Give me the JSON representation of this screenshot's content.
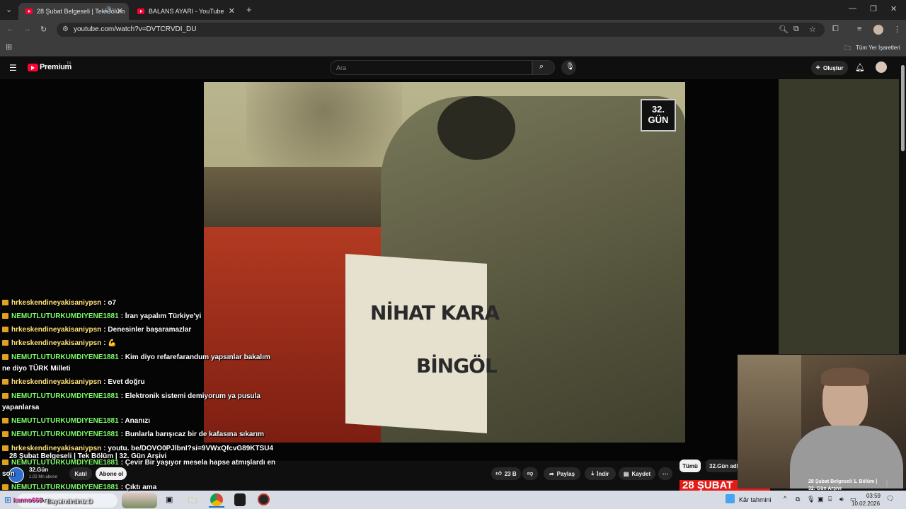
{
  "browser": {
    "tabs": [
      {
        "label": "28 Şubat Belgeseli | Tek Bölüm",
        "active": true
      },
      {
        "label": "BALANS AYARI - YouTube",
        "active": false
      }
    ],
    "url": "youtube.com/watch?v=DVTCRVDI_DU",
    "bookmarks_label": "Tüm Yer İşaretleri"
  },
  "youtube": {
    "logo_text": "Premium",
    "logo_superscript": "TR",
    "search_placeholder": "Ara",
    "create_label": "Oluştur"
  },
  "video": {
    "watermark": "32.\nGÜN",
    "sign_line1": "NİHAT KARA",
    "sign_line2": "BİNGÖL",
    "title": "28 Şubat Belgeseli | Tek Bölüm | 32. Gün Arşivi",
    "channel_name": "32.Gün",
    "subscribers": "1,02 Mn abone",
    "join_label": "Katıl",
    "subscribe_label": "Abone ol",
    "likes": "23 B",
    "share_label": "Paylaş",
    "download_label": "İndir",
    "save_label": "Kaydet"
  },
  "chat": [
    {
      "user": "hrkeskendineyakisaniypsn",
      "user_color": "yellow",
      "text": ": o7"
    },
    {
      "user": "NEMUTLUTURKUMDIYENE1881",
      "user_color": "green",
      "text": ": İran yapalım Türkiye'yi"
    },
    {
      "user": "hrkeskendineyakisaniypsn",
      "user_color": "yellow",
      "text": ": Denesinler başaramazlar"
    },
    {
      "user": "hrkeskendineyakisaniypsn",
      "user_color": "yellow",
      "text": ": 💪"
    },
    {
      "user": "NEMUTLUTURKUMDIYENE1881",
      "user_color": "green",
      "text": ": Kim diyo refarefarandum yapsınlar bakalım",
      "cont": "ne diyo TÜRK Milleti"
    },
    {
      "user": "hrkeskendineyakisaniypsn",
      "user_color": "yellow",
      "text": ": Evet doğru"
    },
    {
      "user": "NEMUTLUTURKUMDIYENE1881",
      "user_color": "green",
      "text": ": Elektronik sistemi demiyorum ya pusula",
      "cont": "yapanlarsa"
    },
    {
      "user": "NEMUTLUTURKUMDIYENE1881",
      "user_color": "green",
      "text": ": Ananızı"
    },
    {
      "user": "NEMUTLUTURKUMDIYENE1881",
      "user_color": "green",
      "text": ": Bunlarla barışıcaz bir de kafasına sıkarım"
    },
    {
      "user": "hrkeskendineyakisaniypsn",
      "user_color": "yellow",
      "text": ": youtu. be/DOVO0PJlbnI?si=9VWxQfcvG89KTSU4"
    },
    {
      "user": "NEMUTLUTURKUMDIYENE1881",
      "user_color": "green",
      "text": ": Çevir Bir yaşıyor mesela hapse atmışlardı en",
      "cont": "son"
    },
    {
      "user": "NEMUTLUTURKUMDIYENE1881",
      "user_color": "green",
      "text": ": Çıktı ama"
    }
  ],
  "sidebar": {
    "chip_all": "Tümü",
    "chip_channel": "32.Gün adlı",
    "rec_title": "28 Şubat Belgeseli 1. Bölüm |",
    "rec_title_2": "32. Gün Arşivi",
    "rec_thumb_text": "28 ŞUBAT"
  },
  "taskbar": {
    "search_label": "Ara",
    "overlay_user": "kanno666",
    "overlay_text": "Bayaindirdiniz:D",
    "weather": "Kâr tahmini",
    "time": "03:59",
    "date": "10.02.2026"
  },
  "colors": {
    "yt_red": "#ff0033",
    "chat_yellow": "#ffe27a",
    "chat_green": "#7dff6a"
  }
}
